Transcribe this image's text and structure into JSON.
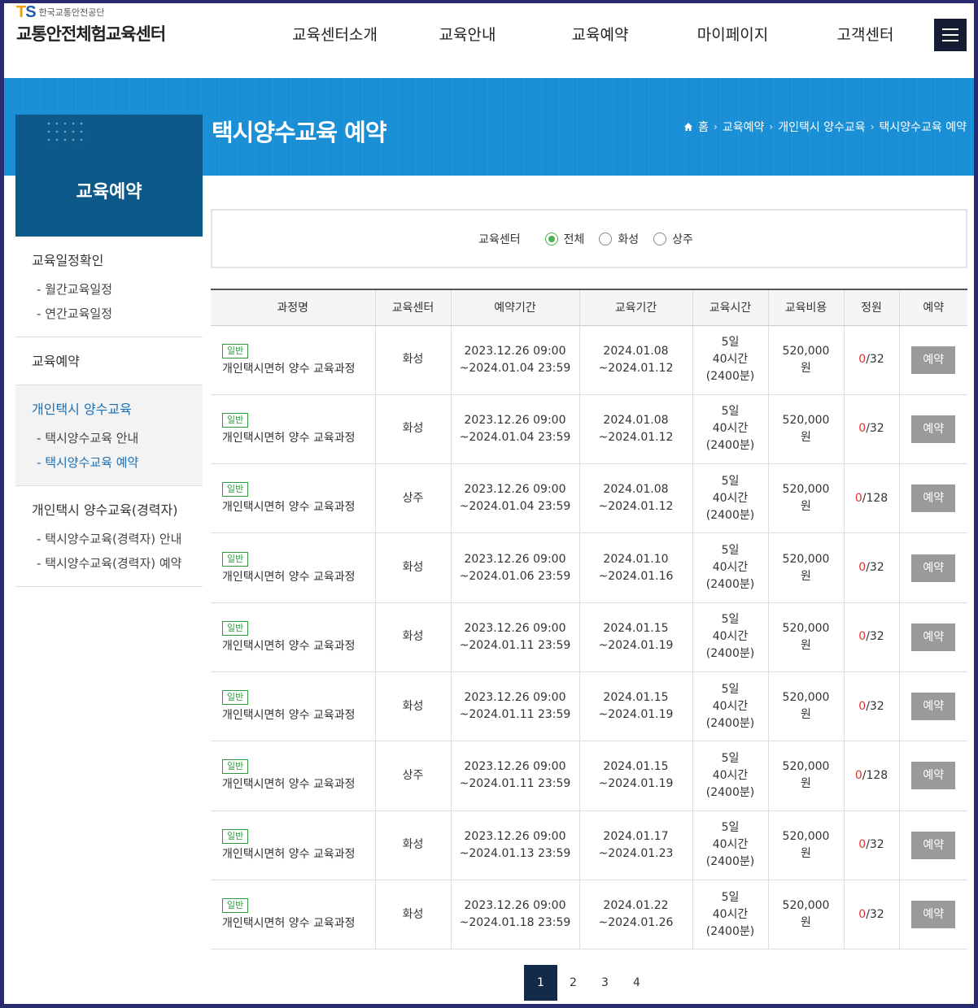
{
  "header": {
    "logo_mark": "TS",
    "logo_org": "한국교통안전공단",
    "logo_name": "교통안전체험교육센터",
    "nav": [
      "교육센터소개",
      "교육안내",
      "교육예약",
      "마이페이지",
      "고객센터"
    ]
  },
  "banner": {
    "title": "택시양수교육 예약",
    "breadcrumb": [
      "홈",
      "교육예약",
      "개인택시 양수교육",
      "택시양수교육 예약"
    ]
  },
  "sidebar": {
    "title": "교육예약",
    "groups": [
      {
        "title": "교육일정확인",
        "items": [
          "월간교육일정",
          "연간교육일정"
        ]
      },
      {
        "title": "교육예약",
        "items": []
      },
      {
        "title": "개인택시 양수교육",
        "items": [
          "택시양수교육 안내",
          "택시양수교육 예약"
        ]
      },
      {
        "title": "개인택시 양수교육(경력자)",
        "items": [
          "택시양수교육(경력자) 안내",
          "택시양수교육(경력자) 예약"
        ]
      }
    ]
  },
  "filter": {
    "label": "교육센터",
    "options": [
      "전체",
      "화성",
      "상주"
    ],
    "selected": "전체"
  },
  "table": {
    "headers": [
      "과정명",
      "교육센터",
      "예약기간",
      "교육기간",
      "교육시간",
      "교육비용",
      "정원",
      "예약"
    ],
    "rows": [
      {
        "badge": "일반",
        "name": "개인택시면허 양수 교육과정",
        "center": "화성",
        "res_start": "2023.12.26 09:00",
        "res_end": "~2024.01.04 23:59",
        "edu_start": "2024.01.08",
        "edu_end": "~2024.01.12",
        "days": "5일",
        "hours": "40시간",
        "mins": "(2400분)",
        "cost": "520,000",
        "won": "원",
        "cur": "0",
        "cap": "/32",
        "btn": "예약"
      },
      {
        "badge": "일반",
        "name": "개인택시면허 양수 교육과정",
        "center": "화성",
        "res_start": "2023.12.26 09:00",
        "res_end": "~2024.01.04 23:59",
        "edu_start": "2024.01.08",
        "edu_end": "~2024.01.12",
        "days": "5일",
        "hours": "40시간",
        "mins": "(2400분)",
        "cost": "520,000",
        "won": "원",
        "cur": "0",
        "cap": "/32",
        "btn": "예약"
      },
      {
        "badge": "일반",
        "name": "개인택시면허 양수 교육과정",
        "center": "상주",
        "res_start": "2023.12.26 09:00",
        "res_end": "~2024.01.04 23:59",
        "edu_start": "2024.01.08",
        "edu_end": "~2024.01.12",
        "days": "5일",
        "hours": "40시간",
        "mins": "(2400분)",
        "cost": "520,000",
        "won": "원",
        "cur": "0",
        "cap": "/128",
        "btn": "예약"
      },
      {
        "badge": "일반",
        "name": "개인택시면허 양수 교육과정",
        "center": "화성",
        "res_start": "2023.12.26 09:00",
        "res_end": "~2024.01.06 23:59",
        "edu_start": "2024.01.10",
        "edu_end": "~2024.01.16",
        "days": "5일",
        "hours": "40시간",
        "mins": "(2400분)",
        "cost": "520,000",
        "won": "원",
        "cur": "0",
        "cap": "/32",
        "btn": "예약"
      },
      {
        "badge": "일반",
        "name": "개인택시면허 양수 교육과정",
        "center": "화성",
        "res_start": "2023.12.26 09:00",
        "res_end": "~2024.01.11 23:59",
        "edu_start": "2024.01.15",
        "edu_end": "~2024.01.19",
        "days": "5일",
        "hours": "40시간",
        "mins": "(2400분)",
        "cost": "520,000",
        "won": "원",
        "cur": "0",
        "cap": "/32",
        "btn": "예약"
      },
      {
        "badge": "일반",
        "name": "개인택시면허 양수 교육과정",
        "center": "화성",
        "res_start": "2023.12.26 09:00",
        "res_end": "~2024.01.11 23:59",
        "edu_start": "2024.01.15",
        "edu_end": "~2024.01.19",
        "days": "5일",
        "hours": "40시간",
        "mins": "(2400분)",
        "cost": "520,000",
        "won": "원",
        "cur": "0",
        "cap": "/32",
        "btn": "예약"
      },
      {
        "badge": "일반",
        "name": "개인택시면허 양수 교육과정",
        "center": "상주",
        "res_start": "2023.12.26 09:00",
        "res_end": "~2024.01.11 23:59",
        "edu_start": "2024.01.15",
        "edu_end": "~2024.01.19",
        "days": "5일",
        "hours": "40시간",
        "mins": "(2400분)",
        "cost": "520,000",
        "won": "원",
        "cur": "0",
        "cap": "/128",
        "btn": "예약"
      },
      {
        "badge": "일반",
        "name": "개인택시면허 양수 교육과정",
        "center": "화성",
        "res_start": "2023.12.26 09:00",
        "res_end": "~2024.01.13 23:59",
        "edu_start": "2024.01.17",
        "edu_end": "~2024.01.23",
        "days": "5일",
        "hours": "40시간",
        "mins": "(2400분)",
        "cost": "520,000",
        "won": "원",
        "cur": "0",
        "cap": "/32",
        "btn": "예약"
      },
      {
        "badge": "일반",
        "name": "개인택시면허 양수 교육과정",
        "center": "화성",
        "res_start": "2023.12.26 09:00",
        "res_end": "~2024.01.18 23:59",
        "edu_start": "2024.01.22",
        "edu_end": "~2024.01.26",
        "days": "5일",
        "hours": "40시간",
        "mins": "(2400분)",
        "cost": "520,000",
        "won": "원",
        "cur": "0",
        "cap": "/32",
        "btn": "예약"
      }
    ]
  },
  "pagination": {
    "pages": [
      "1",
      "2",
      "3",
      "4"
    ],
    "current": "1"
  },
  "colors": {
    "brand_blue": "#1a8fd6",
    "sidebar_head": "#0d5a8a",
    "accent_red": "#e0312c",
    "badge_green": "#2e9a3d",
    "nav_dark": "#142a4a"
  }
}
